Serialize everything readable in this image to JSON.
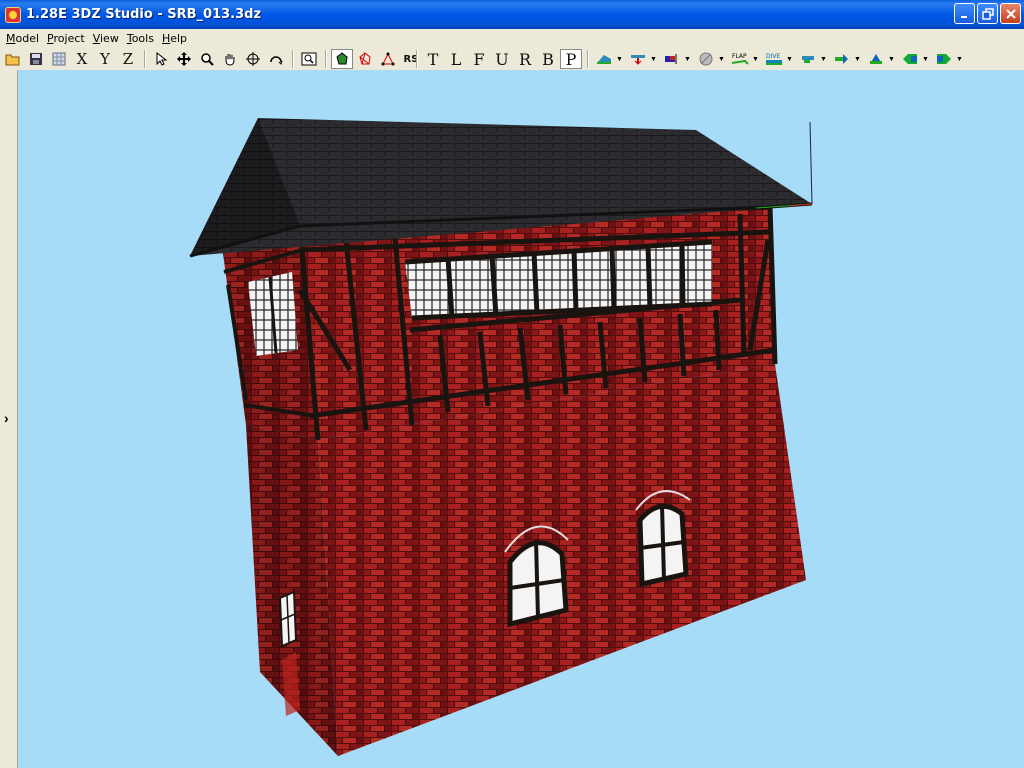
{
  "window": {
    "title": "1.28E 3DZ Studio - SRB_013.3dz"
  },
  "menu": [
    {
      "underline": "M",
      "rest": "odel"
    },
    {
      "underline": "P",
      "rest": "roject"
    },
    {
      "underline": "V",
      "rest": "iew"
    },
    {
      "underline": "T",
      "rest": "ools"
    },
    {
      "underline": "H",
      "rest": "elp"
    }
  ],
  "toolbar": {
    "axis_x": "X",
    "axis_y": "Y",
    "axis_z": "Z",
    "rs_label": "RS",
    "view_t": "T",
    "view_l": "L",
    "view_f": "F",
    "view_u": "U",
    "view_r": "R",
    "view_b": "B",
    "view_p": "P",
    "flap_label": "FLAP",
    "dive_label": "DIVE"
  },
  "colors": {
    "viewport_bg": "#a6dcf8",
    "brick": "#9c1c1c",
    "roof": "#2a2a2e",
    "timber": "#1a1410"
  }
}
